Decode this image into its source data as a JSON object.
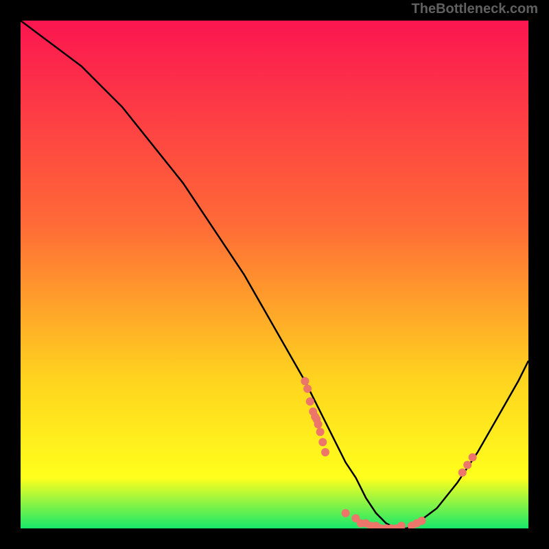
{
  "watermark": "TheBottleneck.com",
  "chart_data": {
    "type": "line",
    "title": "",
    "xlabel": "",
    "ylabel": "",
    "xlim": [
      0,
      100
    ],
    "ylim": [
      0,
      100
    ],
    "series": [
      {
        "name": "curve",
        "x": [
          0,
          4,
          8,
          12,
          16,
          20,
          24,
          28,
          32,
          36,
          40,
          44,
          48,
          52,
          56,
          60,
          62,
          64,
          66,
          68,
          70,
          72,
          74,
          76,
          78,
          82,
          86,
          90,
          94,
          98,
          100
        ],
        "y": [
          100,
          97,
          94,
          91,
          87,
          83,
          78,
          73,
          68,
          62,
          56,
          50,
          43,
          36,
          29,
          21,
          17,
          13,
          10,
          6,
          3,
          1,
          0,
          0,
          1,
          4,
          9,
          15,
          22,
          29,
          33
        ]
      }
    ],
    "scatter_points": {
      "left_cluster": [
        [
          56,
          29
        ],
        [
          56.5,
          27.5
        ],
        [
          57,
          25
        ],
        [
          57.6,
          23
        ],
        [
          58,
          22
        ],
        [
          58.3,
          21.5
        ],
        [
          58.6,
          20.5
        ],
        [
          59,
          19
        ],
        [
          59.5,
          17
        ],
        [
          60,
          15
        ]
      ],
      "trough_cluster": [
        [
          64,
          3
        ],
        [
          66,
          2
        ],
        [
          67,
          1
        ],
        [
          68,
          1
        ],
        [
          69,
          0.5
        ],
        [
          70,
          0.5
        ],
        [
          71,
          0
        ],
        [
          72,
          0
        ],
        [
          73,
          0
        ],
        [
          74,
          0
        ],
        [
          75,
          0.5
        ],
        [
          77,
          0.5
        ],
        [
          78,
          1
        ],
        [
          79,
          1.5
        ]
      ],
      "right_cluster": [
        [
          87,
          11
        ],
        [
          88,
          12.5
        ],
        [
          89,
          14
        ]
      ]
    },
    "gradient": {
      "top": "#fb1650",
      "mid1": "#ff6a37",
      "mid2": "#ffd21f",
      "mid3": "#ffff1c",
      "bottom": "#17e86b"
    },
    "marker_color": "#eb7669",
    "curve_color": "#000000"
  }
}
